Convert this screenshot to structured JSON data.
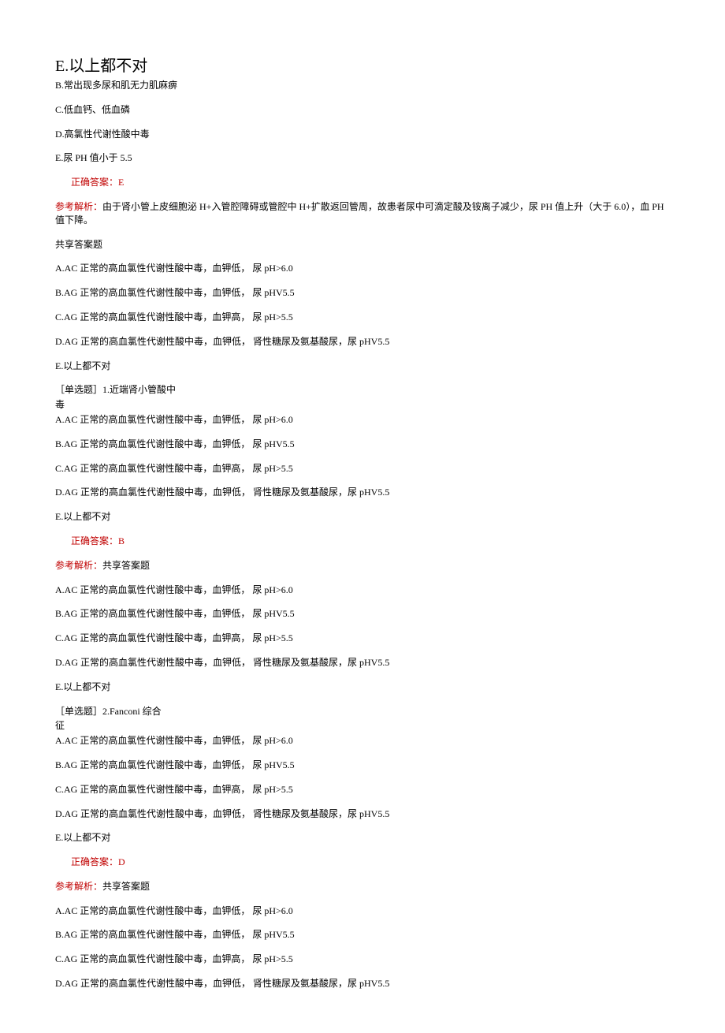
{
  "header_large": "E.以上都不对",
  "q0": {
    "b": "B.常出现多尿和肌无力肌麻痹",
    "c": "C.低血钙、低血磷",
    "d": "D.高氯性代谢性酸中毒",
    "e": "E.尿 PH 值小于 5.5",
    "answer_label": "正确答案：E",
    "explain_label": "参考解析：",
    "explain_text": "由于肾小管上皮细胞泌 H+入管腔障碍或管腔中 H+扩散返回管周，故患者尿中可滴定酸及铵离子减少，尿 PH 值上升（大于 6.0），血 PH 值下降。"
  },
  "shared_label": "共享答案题",
  "options_common": {
    "a": "A.AC 正常的高血氯性代谢性酸中毒，血钾低， 尿 pH>6.0",
    "b": "B.AG 正常的高血氯性代谢性酸中毒，血钾低， 尿 pHV5.5",
    "c": "C.AG 正常的高血氯性代谢性酸中毒，血钾高， 尿 pH>5.5",
    "d": "D.AG 正常的高血氯性代谢性酸中毒，血钾低， 肾性糖尿及氨基酸尿，尿 pHV5.5",
    "e": "E.以上都不对"
  },
  "q1": {
    "title_line1": "［单选题］1.近端肾小管酸中",
    "title_line2": "毒",
    "answer_label": "正确答案：B",
    "explain_label": "参考解析：",
    "explain_text": "共享答案题"
  },
  "q2": {
    "title_line1": "［单选题］2.Fanconi 综合",
    "title_line2": "征",
    "answer_label": "正确答案：D",
    "explain_label": "参考解析：",
    "explain_text": "共享答案题"
  }
}
